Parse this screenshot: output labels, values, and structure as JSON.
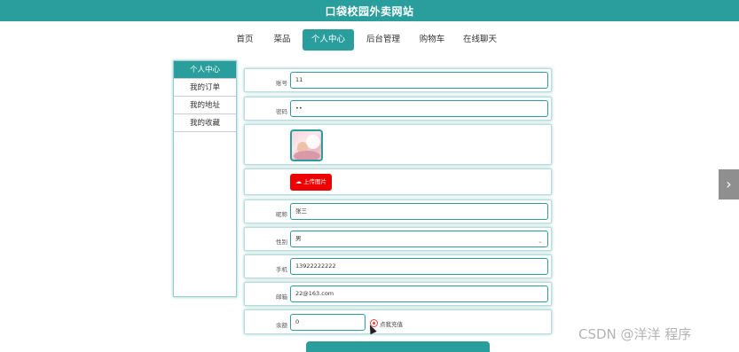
{
  "site": {
    "title": "口袋校园外卖网站"
  },
  "nav": [
    {
      "label": "首页",
      "active": false
    },
    {
      "label": "菜品",
      "active": false
    },
    {
      "label": "个人中心",
      "active": true
    },
    {
      "label": "后台管理",
      "active": false
    },
    {
      "label": "购物车",
      "active": false
    },
    {
      "label": "在线聊天",
      "active": false
    }
  ],
  "sidebar": {
    "items": [
      {
        "label": "个人中心",
        "active": true
      },
      {
        "label": "我的订单",
        "active": false
      },
      {
        "label": "我的地址",
        "active": false
      },
      {
        "label": "我的收藏",
        "active": false
      }
    ]
  },
  "form": {
    "account": {
      "label": "账号",
      "value": "11"
    },
    "password": {
      "label": "密码",
      "value": "••"
    },
    "upload": {
      "label": "上传图片",
      "icon": "cloud-upload-icon"
    },
    "nickname": {
      "label": "昵称",
      "value": "张三"
    },
    "gender": {
      "label": "性别",
      "value": "男"
    },
    "phone": {
      "label": "手机",
      "value": "13922222222"
    },
    "email": {
      "label": "邮箱",
      "value": "22@163.com"
    },
    "balance": {
      "label": "余额",
      "value": "0",
      "recharge_label": "点我充值"
    }
  },
  "watermark": "CSDN @洋洋 程序",
  "colors": {
    "accent": "#2a9d9d",
    "upload": "#ee0000"
  }
}
